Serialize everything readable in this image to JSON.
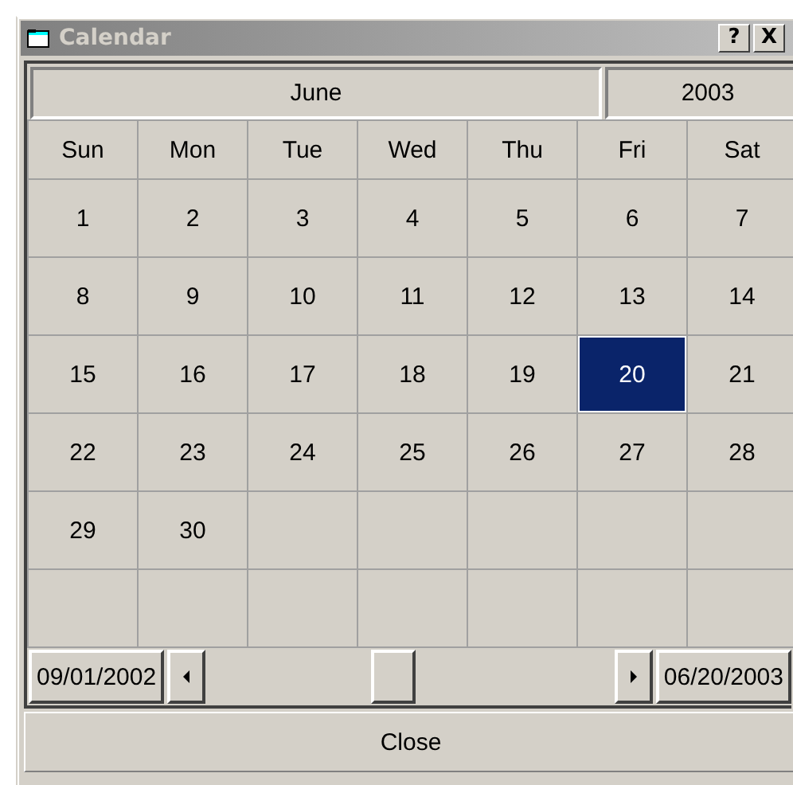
{
  "window": {
    "title": "Calendar",
    "buttons": [
      "?",
      "X"
    ]
  },
  "header": {
    "month": "June",
    "year": "2003"
  },
  "weekdays": [
    "Sun",
    "Mon",
    "Tue",
    "Wed",
    "Thu",
    "Fri",
    "Sat"
  ],
  "weeks": [
    {
      "days": [
        {
          "day": "1",
          "selected": false
        },
        {
          "day": "2",
          "selected": false
        },
        {
          "day": "3",
          "selected": false
        },
        {
          "day": "4",
          "selected": false
        },
        {
          "day": "5",
          "selected": false
        },
        {
          "day": "6",
          "selected": false
        },
        {
          "day": "7",
          "selected": false
        }
      ]
    },
    {
      "days": [
        {
          "day": "8",
          "selected": false
        },
        {
          "day": "9",
          "selected": false
        },
        {
          "day": "10",
          "selected": false
        },
        {
          "day": "11",
          "selected": false
        },
        {
          "day": "12",
          "selected": false
        },
        {
          "day": "13",
          "selected": false
        },
        {
          "day": "14",
          "selected": false
        }
      ]
    },
    {
      "days": [
        {
          "day": "15",
          "selected": false
        },
        {
          "day": "16",
          "selected": false
        },
        {
          "day": "17",
          "selected": false
        },
        {
          "day": "18",
          "selected": false
        },
        {
          "day": "19",
          "selected": false
        },
        {
          "day": "20",
          "selected": true
        },
        {
          "day": "21",
          "selected": false
        }
      ]
    },
    {
      "days": [
        {
          "day": "22",
          "selected": false
        },
        {
          "day": "23",
          "selected": false
        },
        {
          "day": "24",
          "selected": false
        },
        {
          "day": "25",
          "selected": false
        },
        {
          "day": "26",
          "selected": false
        },
        {
          "day": "27",
          "selected": false
        },
        {
          "day": "28",
          "selected": false
        }
      ]
    },
    {
      "days": [
        {
          "day": "29",
          "selected": false
        },
        {
          "day": "30",
          "selected": false
        }
      ]
    }
  ],
  "range": {
    "start": "09/01/2002",
    "end": "06/20/2003"
  },
  "close_button": "Close"
}
